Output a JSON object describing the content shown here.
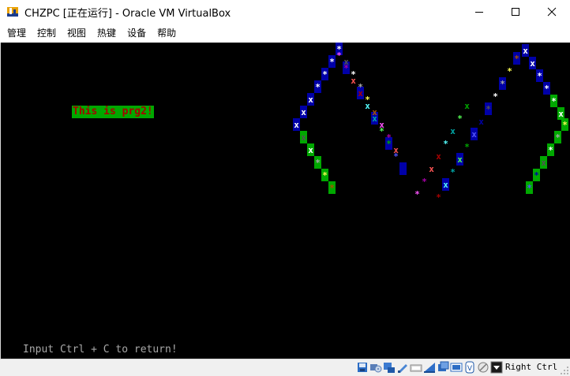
{
  "window": {
    "title": "CHZPC [正在运行] - Oracle VM VirtualBox",
    "controls": [
      "minimize",
      "maximize",
      "close"
    ]
  },
  "menu": {
    "items": [
      "管理",
      "控制",
      "视图",
      "热键",
      "设备",
      "帮助"
    ]
  },
  "vm_screen": {
    "message": "This is prg2!",
    "prompt": "Input Ctrl + C to return!",
    "background": "#000000",
    "message_bg": "#00a800",
    "message_fg": "#a80000",
    "prompt_color": "#a8a8a8"
  },
  "statusbar": {
    "icons": [
      "hard-disk-icon",
      "optical-drive-icon",
      "audio-icon",
      "network-icon",
      "usb-icon",
      "shared-folders-icon",
      "display-icon",
      "video-capture-icon",
      "virtualization-icon",
      "mouse-integration-icon",
      "keyboard-icon"
    ],
    "host_key": "Right Ctrl"
  }
}
